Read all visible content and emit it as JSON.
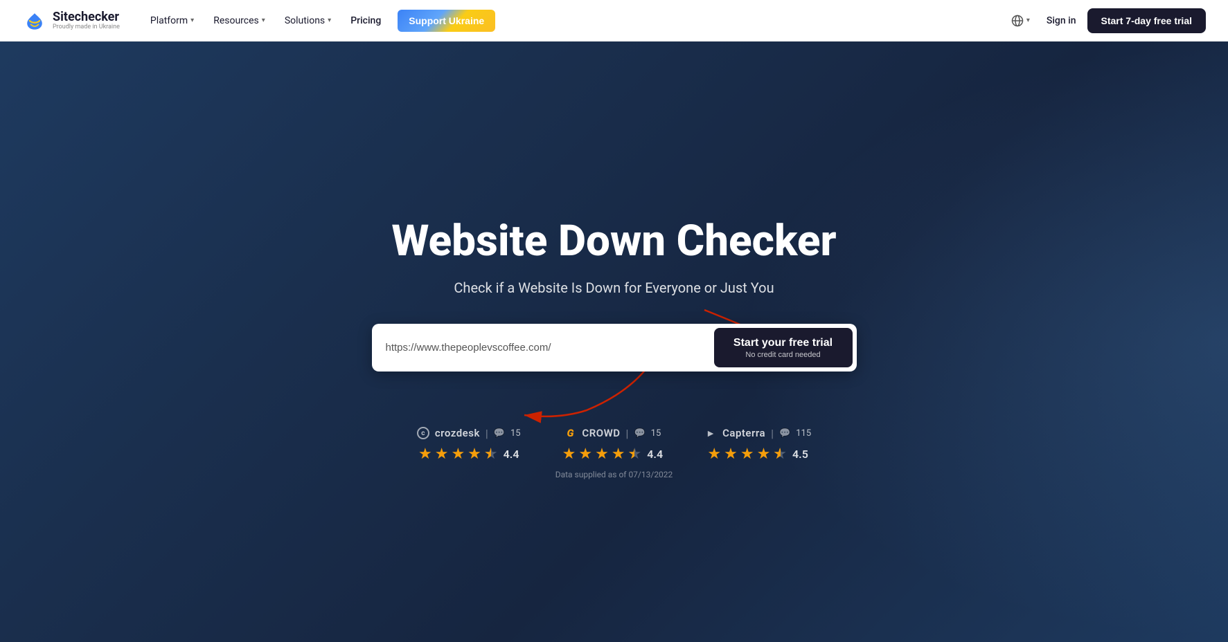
{
  "navbar": {
    "logo_name": "Sitechecker",
    "logo_tagline": "Proudly made in Ukraine",
    "nav_items": [
      {
        "label": "Platform",
        "has_dropdown": true
      },
      {
        "label": "Resources",
        "has_dropdown": true
      },
      {
        "label": "Solutions",
        "has_dropdown": true
      },
      {
        "label": "Pricing",
        "has_dropdown": false
      }
    ],
    "support_btn": "Support Ukraine",
    "globe_label": "",
    "sign_in": "Sign in",
    "start_trial": "Start 7-day free trial"
  },
  "hero": {
    "title": "Website Down Checker",
    "subtitle": "Check if a Website Is Down for Everyone or Just You",
    "input_value": "https://www.thepeoplevscoffee.com/",
    "cta_main": "Start your free trial",
    "cta_sub": "No credit card needed"
  },
  "ratings": {
    "items": [
      {
        "platform": "crozdesk",
        "platform_label": "crozdesk",
        "icon_type": "crozdesk",
        "count": "15",
        "score": "4.4",
        "stars": [
          1,
          1,
          1,
          1,
          0.5
        ]
      },
      {
        "platform": "crowd",
        "platform_label": "CROWD",
        "icon_type": "crowd",
        "count": "15",
        "score": "4.4",
        "stars": [
          1,
          1,
          1,
          1,
          0.5
        ]
      },
      {
        "platform": "capterra",
        "platform_label": "Capterra",
        "icon_type": "capterra",
        "count": "115",
        "score": "4.5",
        "stars": [
          1,
          1,
          1,
          1,
          0.5
        ]
      }
    ],
    "data_note": "Data supplied as of 07/13/2022"
  }
}
